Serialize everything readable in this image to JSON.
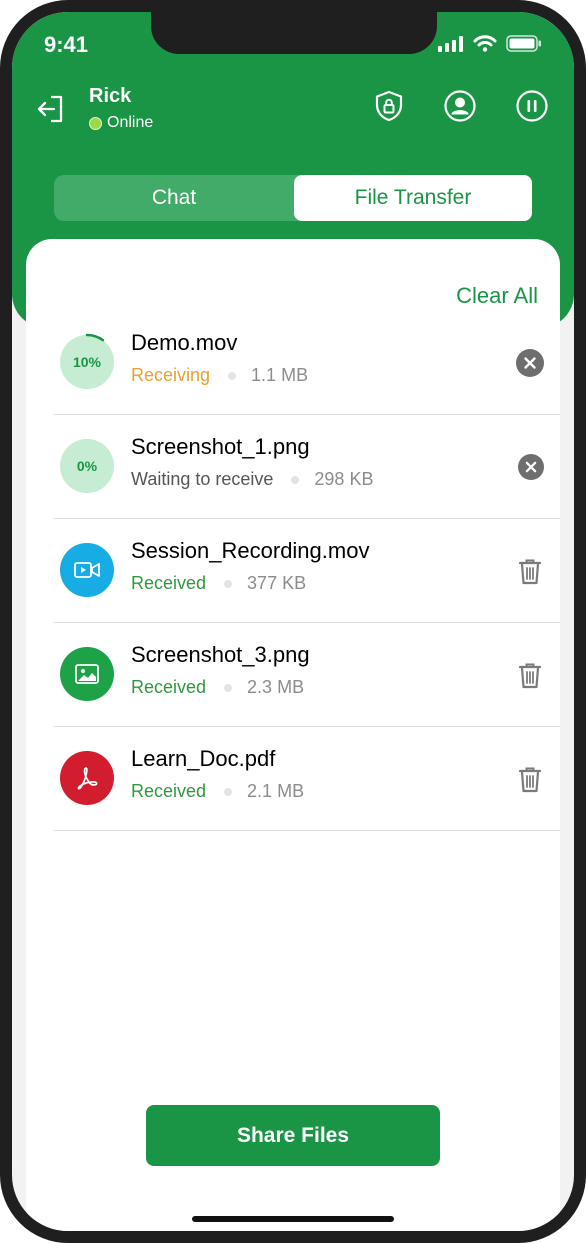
{
  "status_bar": {
    "time": "9:41"
  },
  "header": {
    "user_name": "Rick",
    "user_status": "Online",
    "colors": {
      "primary": "#1a9546",
      "online": "#9cd94a"
    }
  },
  "tabs": [
    {
      "label": "Chat",
      "active": false
    },
    {
      "label": "File Transfer",
      "active": true
    }
  ],
  "clear_all_label": "Clear All",
  "files": [
    {
      "name": "Demo.mov",
      "status": "Receiving",
      "status_color": "#e8a032",
      "size": "1.1 MB",
      "progress_label": "10%",
      "progress": 10,
      "icon": "progress-icon",
      "action": "cancel-icon"
    },
    {
      "name": "Screenshot_1.png",
      "status": "Waiting to receive",
      "status_color": "#555555",
      "size": "298 KB",
      "progress_label": "0%",
      "progress": 0,
      "icon": "progress-icon",
      "action": "cancel-icon"
    },
    {
      "name": "Session_Recording.mov",
      "status": "Received",
      "status_color": "#2e9a3c",
      "size": "377 KB",
      "icon": "video-icon",
      "icon_color": "#18ace4",
      "action": "trash-icon"
    },
    {
      "name": "Screenshot_3.png",
      "status": "Received",
      "status_color": "#2e9a3c",
      "size": "2.3 MB",
      "icon": "image-icon",
      "icon_color": "#1da247",
      "action": "trash-icon"
    },
    {
      "name": "Learn_Doc.pdf",
      "status": "Received",
      "status_color": "#2e9a3c",
      "size": "2.1 MB",
      "icon": "pdf-icon",
      "icon_color": "#d21d2f",
      "action": "trash-icon"
    }
  ],
  "share_button_label": "Share Files"
}
